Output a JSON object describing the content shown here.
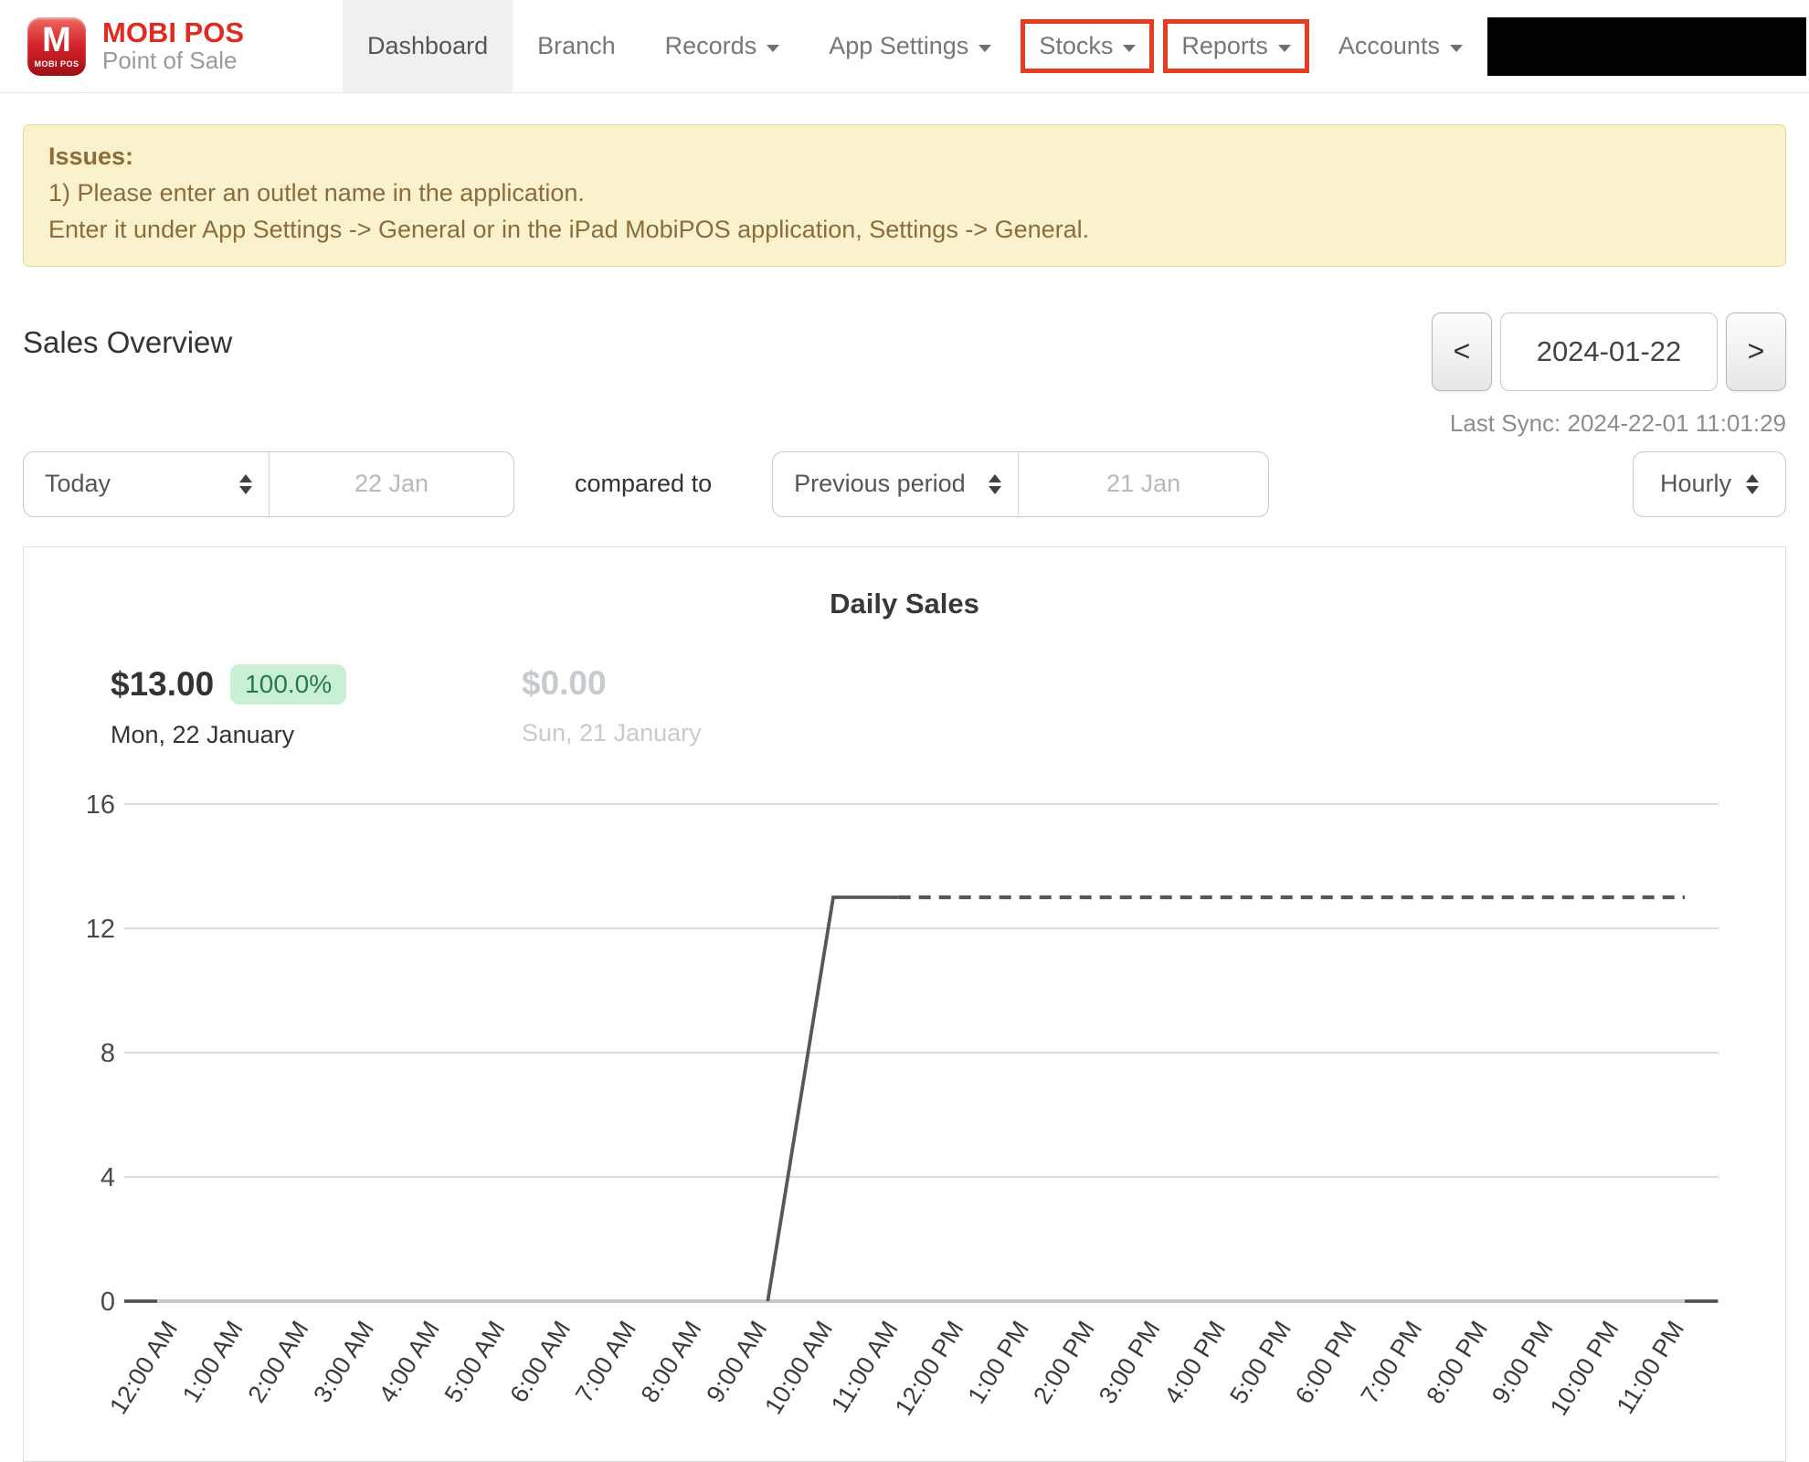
{
  "nav": {
    "brand": {
      "logo_letter": "M",
      "logo_caption": "MOBI POS",
      "title": "MOBI POS",
      "subtitle": "Point of Sale"
    },
    "items": [
      {
        "label": "Dashboard",
        "active": true,
        "dropdown": false,
        "highlighted": false
      },
      {
        "label": "Branch",
        "active": false,
        "dropdown": false,
        "highlighted": false
      },
      {
        "label": "Records",
        "active": false,
        "dropdown": true,
        "highlighted": false
      },
      {
        "label": "App Settings",
        "active": false,
        "dropdown": true,
        "highlighted": false
      },
      {
        "label": "Stocks",
        "active": false,
        "dropdown": true,
        "highlighted": true
      },
      {
        "label": "Reports",
        "active": false,
        "dropdown": true,
        "highlighted": true
      },
      {
        "label": "Accounts",
        "active": false,
        "dropdown": true,
        "highlighted": false
      }
    ]
  },
  "alert": {
    "title": "Issues:",
    "line1": "1) Please enter an outlet name in the application.",
    "line2": "Enter it under App Settings -> General or in the iPad MobiPOS application, Settings -> General."
  },
  "overview": {
    "title": "Sales Overview",
    "prev_label": "<",
    "date_value": "2024-01-22",
    "next_label": ">",
    "last_sync": "Last Sync: 2024-22-01 11:01:29"
  },
  "filters": {
    "period_select": "Today",
    "period_date": "22 Jan",
    "compared_to": "compared to",
    "compare_select": "Previous period",
    "compare_date": "21 Jan",
    "granularity_select": "Hourly"
  },
  "chart": {
    "title": "Daily Sales",
    "current": {
      "amount": "$13.00",
      "change": "100.0%",
      "date": "Mon, 22 January"
    },
    "previous": {
      "amount": "$0.00",
      "date": "Sun, 21 January"
    }
  },
  "chart_data": {
    "type": "line",
    "title": "Daily Sales",
    "x": [
      "12:00 AM",
      "1:00 AM",
      "2:00 AM",
      "3:00 AM",
      "4:00 AM",
      "5:00 AM",
      "6:00 AM",
      "7:00 AM",
      "8:00 AM",
      "9:00 AM",
      "10:00 AM",
      "11:00 AM",
      "12:00 PM",
      "1:00 PM",
      "2:00 PM",
      "3:00 PM",
      "4:00 PM",
      "5:00 PM",
      "6:00 PM",
      "7:00 PM",
      "8:00 PM",
      "9:00 PM",
      "10:00 PM",
      "11:00 PM"
    ],
    "series": [
      {
        "name": "Mon, 22 January",
        "color": "#57575a",
        "values": [
          0,
          0,
          0,
          0,
          0,
          0,
          0,
          0,
          0,
          0,
          13,
          13,
          13,
          13,
          13,
          13,
          13,
          13,
          13,
          13,
          13,
          13,
          13,
          13
        ],
        "rise_start_index": 9,
        "solid_until_index": 11,
        "dashed_after": true
      },
      {
        "name": "Sun, 21 January",
        "color": "#c9c9c9",
        "values": [
          0,
          0,
          0,
          0,
          0,
          0,
          0,
          0,
          0,
          0,
          0,
          0,
          0,
          0,
          0,
          0,
          0,
          0,
          0,
          0,
          0,
          0,
          0,
          0
        ]
      }
    ],
    "yticks": [
      0,
      4,
      8,
      12,
      16
    ],
    "ylim": [
      0,
      16
    ],
    "grid": true,
    "legend_position": "none"
  },
  "colors": {
    "accent_red": "#e73b22",
    "brand_red": "#d5232b",
    "warning_bg": "#faf2cd",
    "warning_text": "#8a6d3b",
    "badge_bg": "#c9efd4",
    "badge_text": "#257a49",
    "line_today": "#57575a",
    "line_previous": "#c9c9c9",
    "gridline": "#d9d9d9"
  }
}
